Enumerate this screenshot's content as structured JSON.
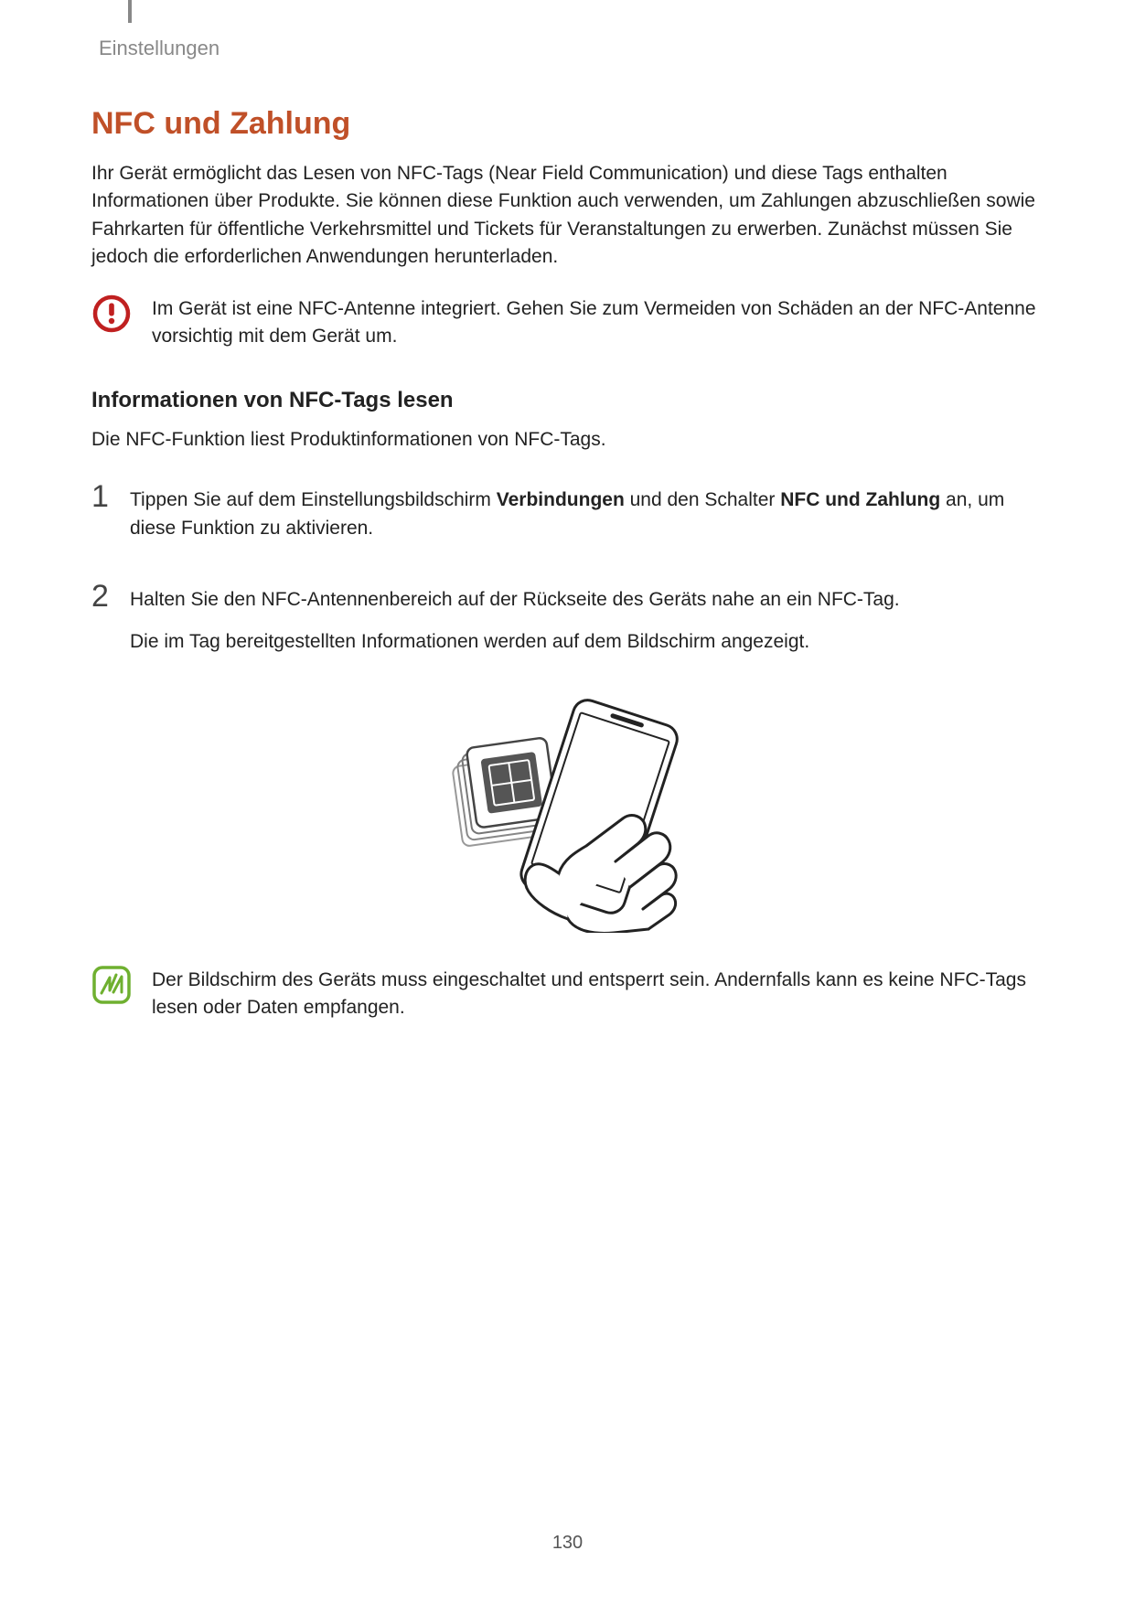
{
  "breadcrumb": "Einstellungen",
  "title": "NFC und Zahlung",
  "intro": "Ihr Gerät ermöglicht das Lesen von NFC-Tags (Near Field Communication) und diese Tags enthalten Informationen über Produkte. Sie können diese Funktion auch verwenden, um Zahlungen abzuschließen sowie Fahrkarten für öffentliche Verkehrsmittel und Tickets für Veranstaltungen zu erwerben. Zunächst müssen Sie jedoch die erforderlichen Anwendungen herunterladen.",
  "warning": "Im Gerät ist eine NFC-Antenne integriert. Gehen Sie zum Vermeiden von Schäden an der NFC-Antenne vorsichtig mit dem Gerät um.",
  "subtitle": "Informationen von NFC-Tags lesen",
  "sub_intro": "Die NFC-Funktion liest Produktinformationen von NFC-Tags.",
  "steps": [
    {
      "num": "1",
      "pre": "Tippen Sie auf dem Einstellungsbildschirm ",
      "bold1": "Verbindungen",
      "mid": " und den Schalter ",
      "bold2": "NFC und Zahlung",
      "post": " an, um diese Funktion zu aktivieren."
    },
    {
      "num": "2",
      "line1": "Halten Sie den NFC-Antennenbereich auf der Rückseite des Geräts nahe an ein NFC-Tag.",
      "line2": "Die im Tag bereitgestellten Informationen werden auf dem Bildschirm angezeigt."
    }
  ],
  "note": "Der Bildschirm des Geräts muss eingeschaltet und entsperrt sein. Andernfalls kann es keine NFC-Tags lesen oder Daten empfangen.",
  "page_number": "130"
}
